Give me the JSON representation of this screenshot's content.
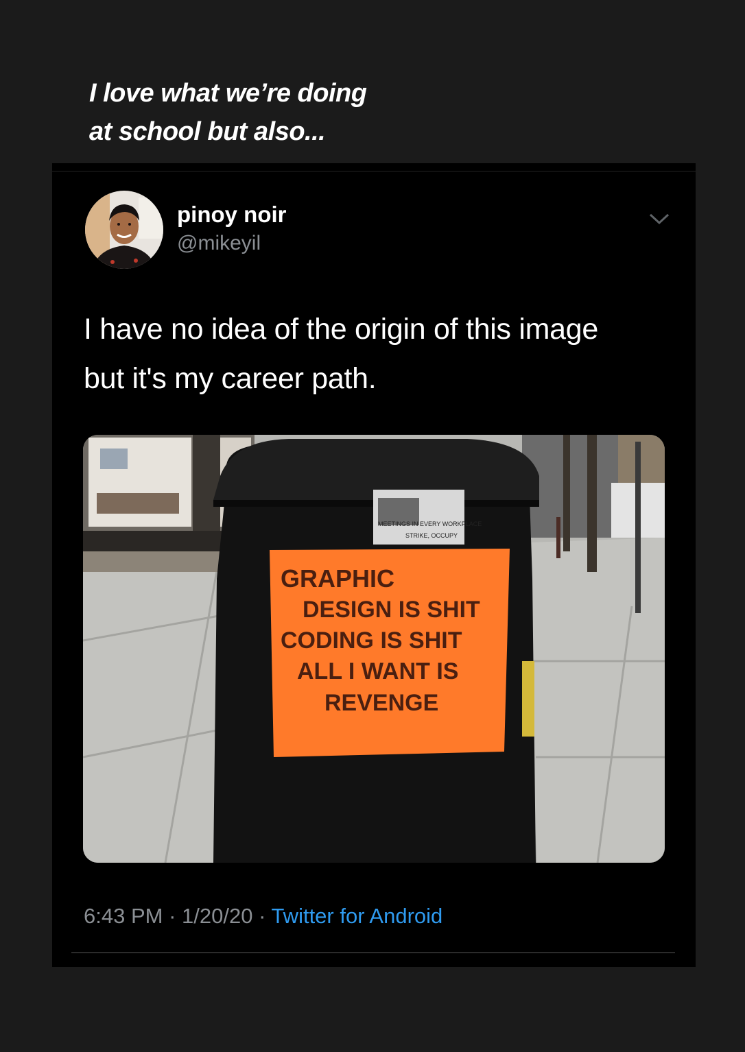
{
  "story_caption": {
    "line1": "I love what we’re doing",
    "line2": "at school but also..."
  },
  "tweet": {
    "display_name": "pinoy noir",
    "handle": "@mikeyil",
    "text_line1": "I have no idea of the origin of this image",
    "text_line2": "but it's my career path.",
    "time": "6:43 PM",
    "date": "1/20/20",
    "source": "Twitter for Android",
    "separator": " · "
  },
  "photo": {
    "sign_lines": [
      "GRAPHIC",
      "DESIGN IS SHIT",
      "CODING IS SHIT",
      "ALL I WANT IS",
      "REVENGE"
    ],
    "sticker_line1": "MEETINGS IN EVERY WORKPLACE",
    "sticker_line2": "STRIKE, OCCUPY"
  },
  "colors": {
    "background": "#1b1b1b",
    "card": "#000000",
    "link": "#2f9bf0",
    "muted": "#8b8f94",
    "sign_orange": "#ff7a2a"
  },
  "icons": {
    "menu": "chevron-down-icon"
  }
}
